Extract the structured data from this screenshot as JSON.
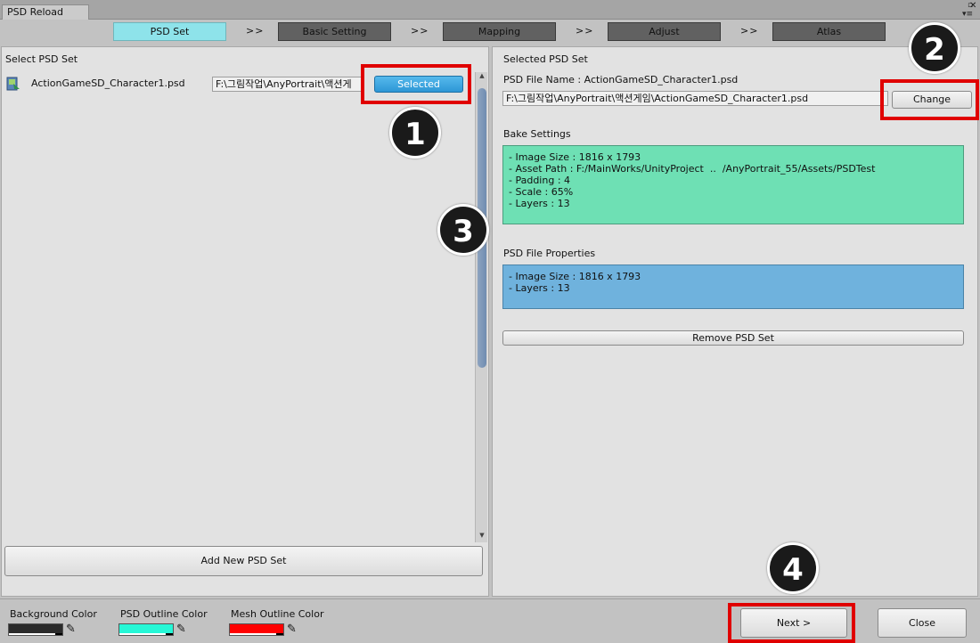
{
  "window": {
    "title": "PSD Reload"
  },
  "steps": [
    {
      "label": "PSD Set",
      "active": true
    },
    {
      "label": "Basic Setting",
      "active": false
    },
    {
      "label": "Mapping",
      "active": false
    },
    {
      "label": "Adjust",
      "active": false
    },
    {
      "label": "Atlas",
      "active": false
    }
  ],
  "step_separator": ">>",
  "left": {
    "heading": "Select PSD Set",
    "item": {
      "name": "ActionGameSD_Character1.psd",
      "path": "F:\\그림작업\\AnyPortrait\\액션게",
      "button": "Selected",
      "icon": "psd-file-icon"
    },
    "add_button": "Add New PSD Set"
  },
  "right": {
    "heading": "Selected PSD Set",
    "file_name_line": "PSD File Name : ActionGameSD_Character1.psd",
    "file_path": "F:\\그림작업\\AnyPortrait\\액션게임\\ActionGameSD_Character1.psd",
    "change_button": "Change",
    "bake_heading": "Bake Settings",
    "bake_lines": "- Image Size : 1816 x 1793\n- Asset Path : F:/MainWorks/UnityProject  ..  /AnyPortrait_55/Assets/PSDTest\n- Padding : 4\n- Scale : 65%\n- Layers : 13",
    "props_heading": "PSD File Properties",
    "props_lines": "- Image Size : 1816 x 1793\n- Layers : 13",
    "remove_button": "Remove PSD Set"
  },
  "footer": {
    "bg_color_label": "Background Color",
    "psd_outline_label": "PSD Outline Color",
    "mesh_outline_label": "Mesh Outline Color",
    "next_button": "Next >",
    "close_button": "Close"
  },
  "badges": [
    "1",
    "2",
    "3",
    "4"
  ],
  "colors": {
    "background": "#2b2b2b",
    "psd_outline": "#26f7d6",
    "mesh_outline": "#ff0000",
    "active_step": "#8ee3ea",
    "inactive_step": "#616161",
    "bake_box": "#6ee0b4",
    "props_box": "#6fb2dd",
    "selected_button": "#3aa6e0",
    "highlight": "#e00000"
  }
}
